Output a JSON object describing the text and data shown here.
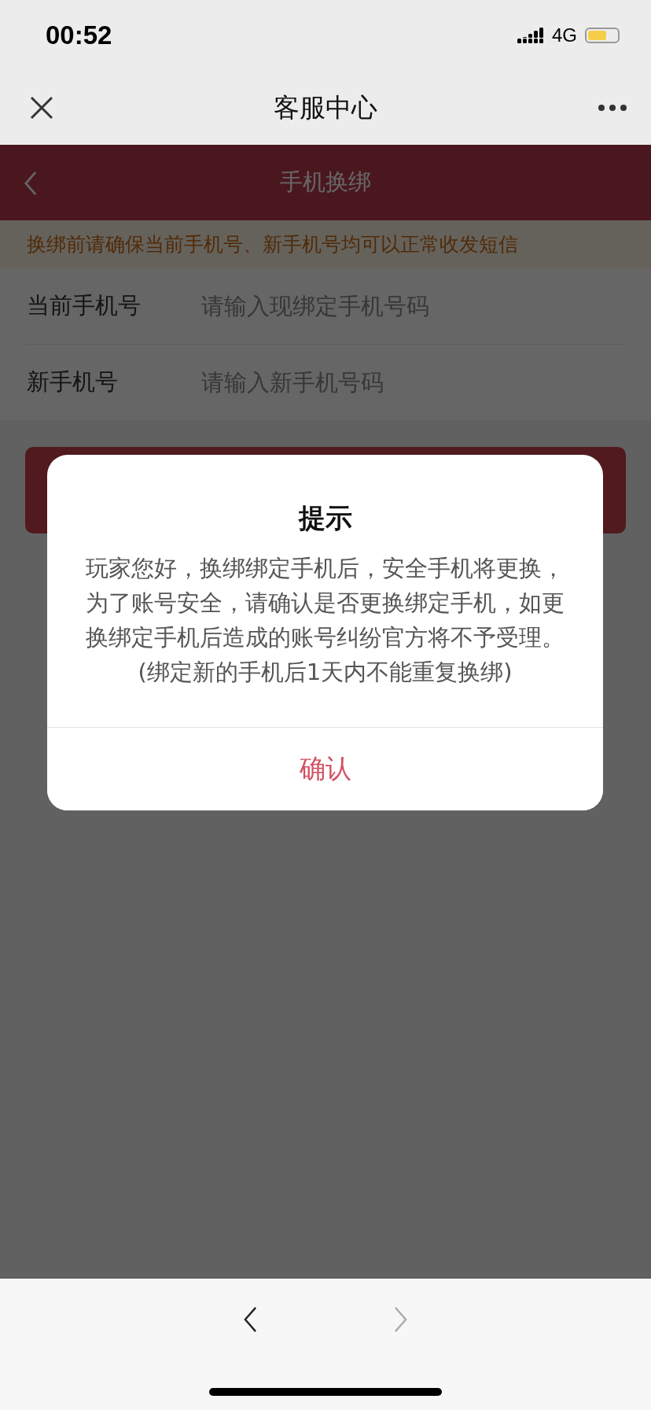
{
  "status_bar": {
    "time": "00:52",
    "network": "4G",
    "battery": {
      "level": 0.65
    }
  },
  "nav_bar": {
    "title": "客服中心"
  },
  "page": {
    "header": {
      "title": "手机换绑"
    },
    "notice": "换绑前请确保当前手机号、新手机号均可以正常收发短信",
    "fields": [
      {
        "label": "当前手机号",
        "placeholder": "请输入现绑定手机号码"
      },
      {
        "label": "新手机号",
        "placeholder": "请输入新手机号码"
      }
    ]
  },
  "dialog": {
    "title": "提示",
    "message": "玩家您好，换绑绑定手机后，安全手机将更换，为了账号安全，请确认是否更换绑定手机，如更换绑定手机后造成的账号纠纷官方将不予受理。(绑定新的手机后1天内不能重复换绑)",
    "confirm": "确认"
  },
  "toolbar": {
    "back": {
      "disabled": false
    },
    "forward": {
      "disabled": true
    }
  }
}
